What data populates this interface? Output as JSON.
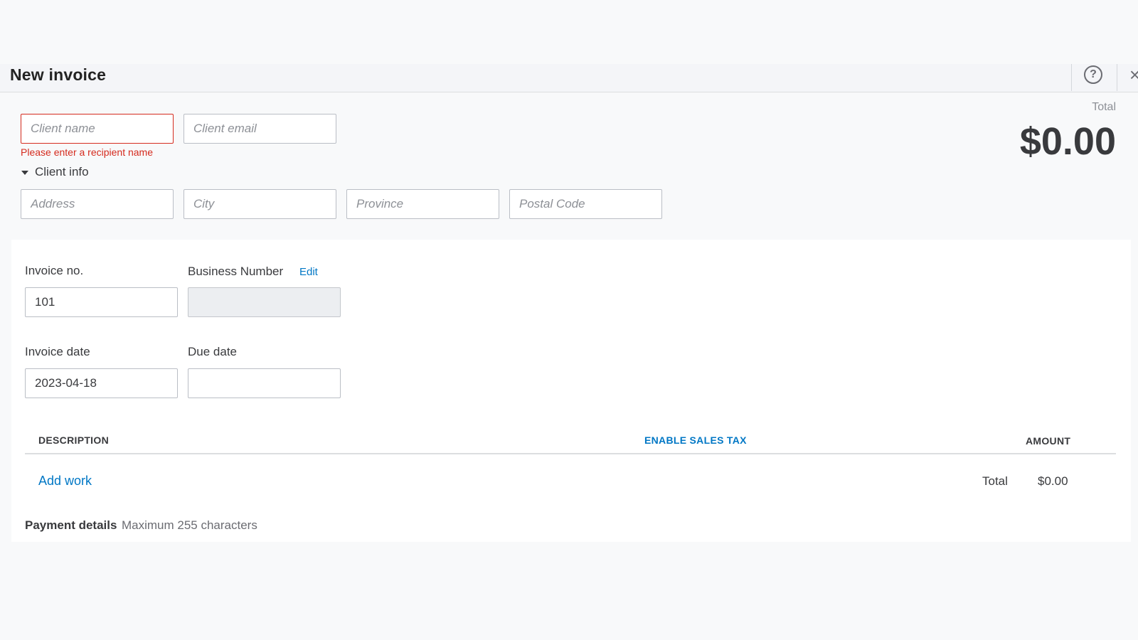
{
  "header": {
    "title": "New invoice",
    "help_label": "?",
    "close_label": "×"
  },
  "client": {
    "name_placeholder": "Client name",
    "email_placeholder": "Client email",
    "name_error": "Please enter a recipient name",
    "info_toggle_label": "Client info",
    "address_placeholder": "Address",
    "city_placeholder": "City",
    "province_placeholder": "Province",
    "postal_placeholder": "Postal Code"
  },
  "summary": {
    "total_label": "Total",
    "total_amount": "$0.00"
  },
  "invoice": {
    "number_label": "Invoice no.",
    "number_value": "101",
    "business_number_label": "Business Number",
    "business_number_edit": "Edit",
    "business_number_value": "",
    "date_label": "Invoice date",
    "date_value": "2023-04-18",
    "due_label": "Due date",
    "due_value": ""
  },
  "table": {
    "col_description": "DESCRIPTION",
    "col_sales_tax": "ENABLE SALES TAX",
    "col_amount": "AMOUNT",
    "add_work": "Add work",
    "total_label": "Total",
    "total_value": "$0.00"
  },
  "payment": {
    "label": "Payment details",
    "hint": "Maximum 255 characters"
  },
  "colors": {
    "accent": "#0077c5",
    "error": "#d52b1e"
  }
}
